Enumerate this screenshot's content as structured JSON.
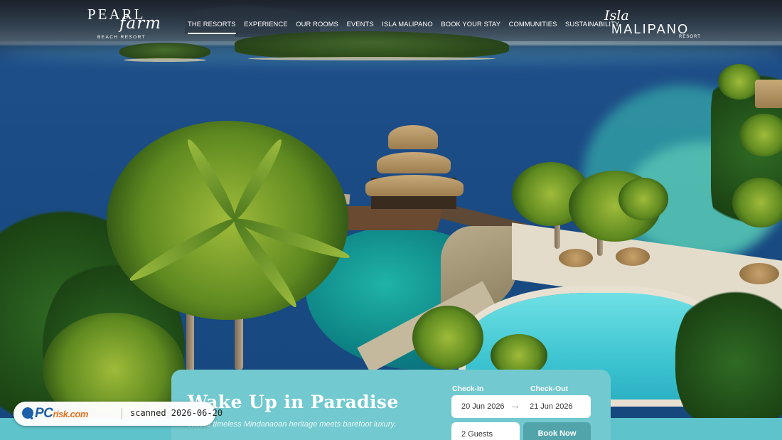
{
  "brand": {
    "logo_left": {
      "line1": "PEARL",
      "line2": "farm",
      "line3": "BEACH RESORT"
    },
    "logo_right": {
      "line1": "Isla",
      "line2": "MALIPANO",
      "line3": "RESORT"
    }
  },
  "nav": {
    "items": [
      {
        "label": "THE RESORTS",
        "active": true
      },
      {
        "label": "EXPERIENCE",
        "active": false
      },
      {
        "label": "OUR ROOMS",
        "active": false
      },
      {
        "label": "EVENTS",
        "active": false
      },
      {
        "label": "ISLA MALIPANO",
        "active": false
      },
      {
        "label": "BOOK YOUR STAY",
        "active": false
      },
      {
        "label": "COMMUNITIES",
        "active": false
      },
      {
        "label": "SUSTAINABILITY",
        "active": false
      }
    ]
  },
  "hero": {
    "headline": "Wake Up in Paradise",
    "tagline": "Where timeless Mindanaoan heritage meets barefoot luxury."
  },
  "booking": {
    "checkin_label": "Check-In",
    "checkout_label": "Check-Out",
    "checkin_date": "20 Jun 2026",
    "checkout_date": "21 Jun 2026",
    "arrow_icon": "arrow-right-icon",
    "guests": "2 Guests",
    "book_button": "Book Now"
  },
  "watermark": {
    "logo_text": "PC",
    "logo_suffix": "risk.com",
    "scan_text": "scanned 2026-06-20"
  },
  "colors": {
    "band": "#5ec3cb",
    "card": "#72c9cf",
    "book_button": "#52a4ab",
    "text_light": "#ffffff"
  }
}
